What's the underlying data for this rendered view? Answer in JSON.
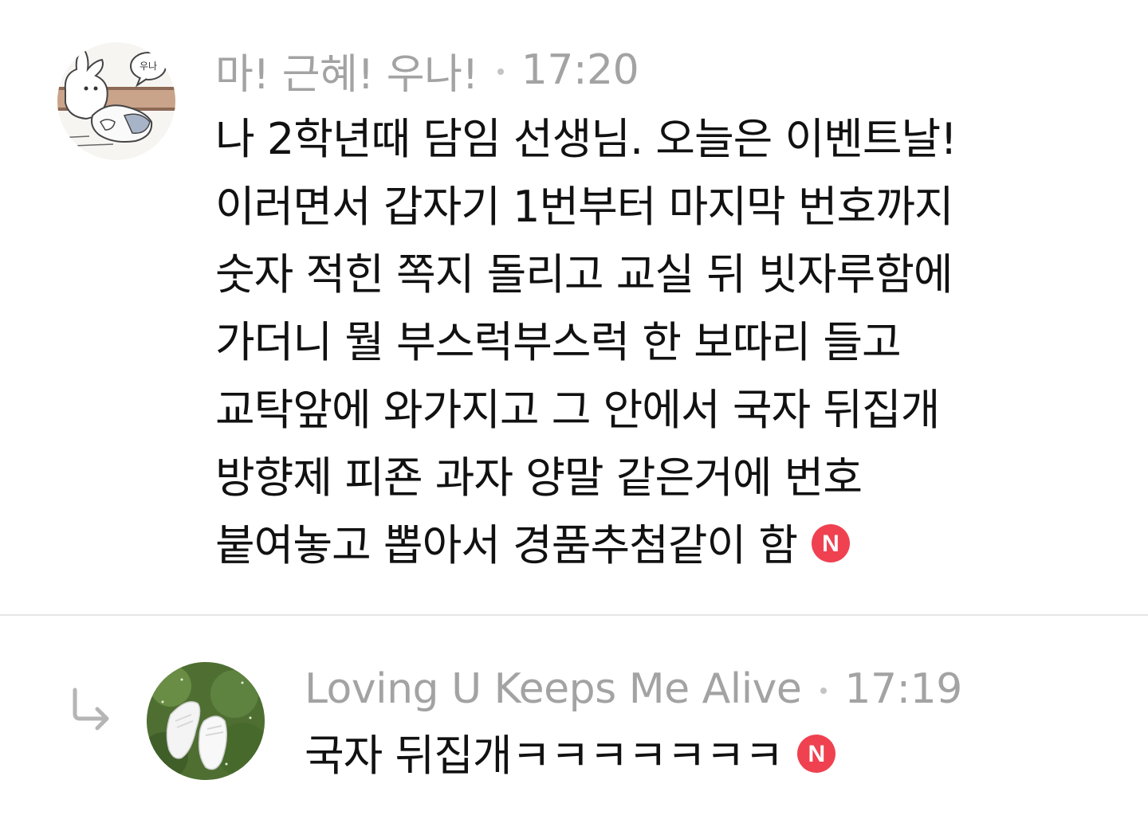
{
  "comments": [
    {
      "author": "마! 근혜! 우나!",
      "time": "17:20",
      "text_lines": [
        "나 2학년때 담임 선생님. 오늘은 이벤트날!",
        "이러면서 갑자기 1번부터 마지막 번호까지",
        "숫자 적힌 쪽지 돌리고 교실 뒤 빗자루함에",
        "가더니 뭘 부스럭부스럭 한 보따리 들고",
        "교탁앞에 와가지고 그 안에서 국자 뒤집개",
        "방향제 피죤 과자 양말 같은거에 번호",
        "붙여놓고 뽑아서 경품추첨같이 함"
      ],
      "badge": "N",
      "avatar_text": "우나",
      "avatar_icon": "cartoon-rabbit-avatar"
    }
  ],
  "reply": {
    "author": "Loving U Keeps Me Alive",
    "time": "17:19",
    "text": "국자 뒤집개ㅋㅋㅋㅋㅋㅋㅋ",
    "badge": "N",
    "avatar_icon": "sneakers-on-grass-avatar",
    "reply_icon": "reply-arrow-icon"
  },
  "colors": {
    "meta": "#a3a3a3",
    "text": "#111111",
    "badge": "#ef4150",
    "divider": "#e6e6e6"
  }
}
